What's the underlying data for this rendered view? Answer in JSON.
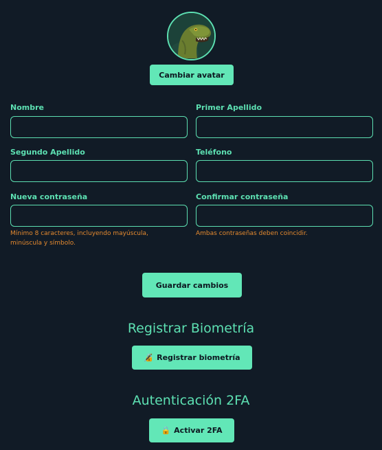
{
  "profile": {
    "change_avatar_label": "Cambiar avatar"
  },
  "form": {
    "fields": {
      "nombre": {
        "label": "Nombre",
        "value": "",
        "placeholder": ""
      },
      "primer_apellido": {
        "label": "Primer Apellido",
        "value": "",
        "placeholder": ""
      },
      "segundo_apellido": {
        "label": "Segundo Apellido",
        "value": "",
        "placeholder": ""
      },
      "telefono": {
        "label": "Teléfono",
        "value": "",
        "placeholder": ""
      },
      "nueva_contrasena": {
        "label": "Nueva contraseña",
        "value": "",
        "placeholder": "",
        "hint_line1": "Mínimo 8 caracteres, incluyendo mayúscula,",
        "hint_line2": "minúscula y símbolo."
      },
      "confirmar_contrasena": {
        "label": "Confirmar contraseña",
        "value": "",
        "placeholder": "",
        "hint": "Ambas contraseñas deben coincidir."
      }
    },
    "save_label": "Guardar cambios"
  },
  "biometrics": {
    "title": "Registrar Biometría",
    "button_label": "Registrar biometría",
    "button_icon": "fingerprint-lock-icon"
  },
  "twofa": {
    "title": "Autenticación 2FA",
    "button_label": "Activar 2FA",
    "button_icon": "lock-icon"
  },
  "colors": {
    "background": "#111b26",
    "accent": "#5de0b2",
    "button": "#62e7b7",
    "hint": "#e58a2f"
  }
}
